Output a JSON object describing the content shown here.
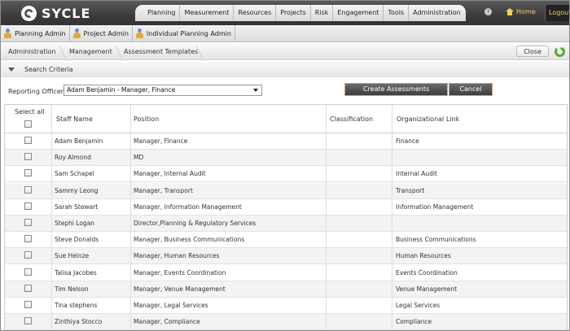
{
  "app": {
    "logo_text": "SYCLE",
    "nav": [
      "Planning",
      "Measurement",
      "Resources",
      "Projects",
      "Risk",
      "Engagement",
      "Tools",
      "Administration"
    ],
    "help": "?",
    "home_label": "Home",
    "logout_label": "Logout",
    "gold_color": "#f2d060"
  },
  "roles": [
    "Planning Admin",
    "Project Admin",
    "Individual Planning Admin"
  ],
  "breadcrumb": [
    "Administration",
    "Management",
    "Assessment Templates"
  ],
  "close_label": "Close",
  "criteria": {
    "title": "Search Criteria",
    "officer_label": "Reporting Officer",
    "officer_value": "Adam Benjamin - Manager, Finance",
    "create_label": "Create Assessments",
    "cancel_label": "Cancel"
  },
  "table": {
    "headers": {
      "select_all": "Select all",
      "name": "Staff Name",
      "position": "Position",
      "classification": "Classification",
      "org_link": "Organizational Link"
    },
    "rows": [
      {
        "name": "Adam Benjamin",
        "position": "Manager, Finance",
        "classification": "",
        "org": "Finance"
      },
      {
        "name": "Roy Almond",
        "position": "MD",
        "classification": "",
        "org": ""
      },
      {
        "name": "Sam Schapel",
        "position": "Manager, Internal Audit",
        "classification": "",
        "org": "Internal Audit"
      },
      {
        "name": "Sammy Leong",
        "position": "Manager, Transport",
        "classification": "",
        "org": "Transport"
      },
      {
        "name": "Sarah Stewart",
        "position": "Manager, Information Management",
        "classification": "",
        "org": "Information Management"
      },
      {
        "name": "Stephi Logan",
        "position": "Director,Planning & Regulatory Services",
        "classification": "",
        "org": ""
      },
      {
        "name": "Steve Donalds",
        "position": "Manager, Business Communications",
        "classification": "",
        "org": "Business Communications"
      },
      {
        "name": "Sue Heinze",
        "position": "Manager, Human Resources",
        "classification": "",
        "org": "Human Resources"
      },
      {
        "name": "Talisa Jacobes",
        "position": "Manager, Events Coordination",
        "classification": "",
        "org": "Events Coordination"
      },
      {
        "name": "Tim Nelson",
        "position": "Manager, Venue Management",
        "classification": "",
        "org": "Venue Management"
      },
      {
        "name": "Tina stephens",
        "position": "Manager, Legal Services",
        "classification": "",
        "org": "Legal Services"
      },
      {
        "name": "Zinthiya Stocco",
        "position": "Manager, Compliance",
        "classification": "",
        "org": "Compliance"
      }
    ]
  }
}
